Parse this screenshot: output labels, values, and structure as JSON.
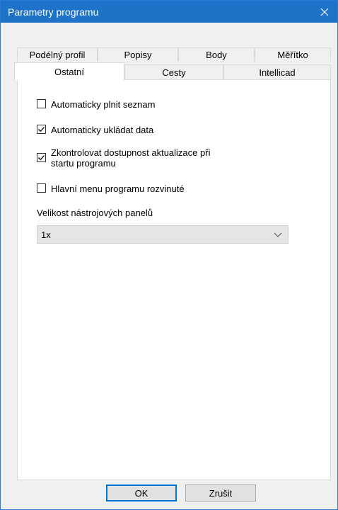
{
  "window": {
    "title": "Parametry programu"
  },
  "tabs": {
    "row_back": [
      "Podélný profil",
      "Popisy",
      "Body",
      "Měřítko"
    ],
    "row_front": [
      "Ostatní",
      "Cesty",
      "Intellicad"
    ],
    "active": "Ostatní"
  },
  "options": [
    {
      "label": "Automaticky plnit seznam",
      "checked": false
    },
    {
      "label": "Automaticky ukládat data",
      "checked": true
    },
    {
      "label_line1": "Zkontrolovat dostupnost aktualizace při",
      "label_line2": "startu programu",
      "checked": true
    },
    {
      "label": "Hlavní menu programu rozvinuté",
      "checked": false
    }
  ],
  "toolbar_size": {
    "label": "Velikost nástrojových panelů",
    "value": "1x"
  },
  "buttons": {
    "ok": "OK",
    "cancel": "Zrušit"
  },
  "colors": {
    "titlebar": "#1e73c9",
    "focus": "#0078d7"
  },
  "icons": {
    "close": "close-icon",
    "dropdown": "chevron-down-icon",
    "check": "check-icon"
  }
}
